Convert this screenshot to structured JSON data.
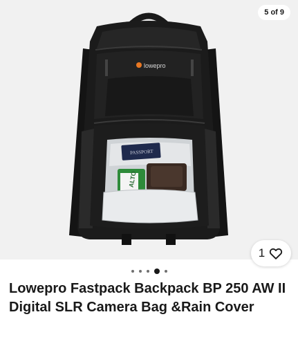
{
  "gallery": {
    "counter": "5 of 9",
    "brand_text": "lowepro",
    "passport_text": "PASSPORT",
    "card_text": "ALTO",
    "dots": [
      {
        "active": false
      },
      {
        "active": false
      },
      {
        "active": false
      },
      {
        "active": true
      },
      {
        "active": false
      }
    ]
  },
  "watch": {
    "count": "1",
    "icon": "heart-outline-icon"
  },
  "listing": {
    "title": "Lowepro Fastpack Backpack BP 250 AW II Digital SLR Camera Bag &Rain Cover"
  },
  "colors": {
    "background": "#f1f1f1",
    "bag": "#1b1b1b",
    "accent": "#e87722"
  }
}
